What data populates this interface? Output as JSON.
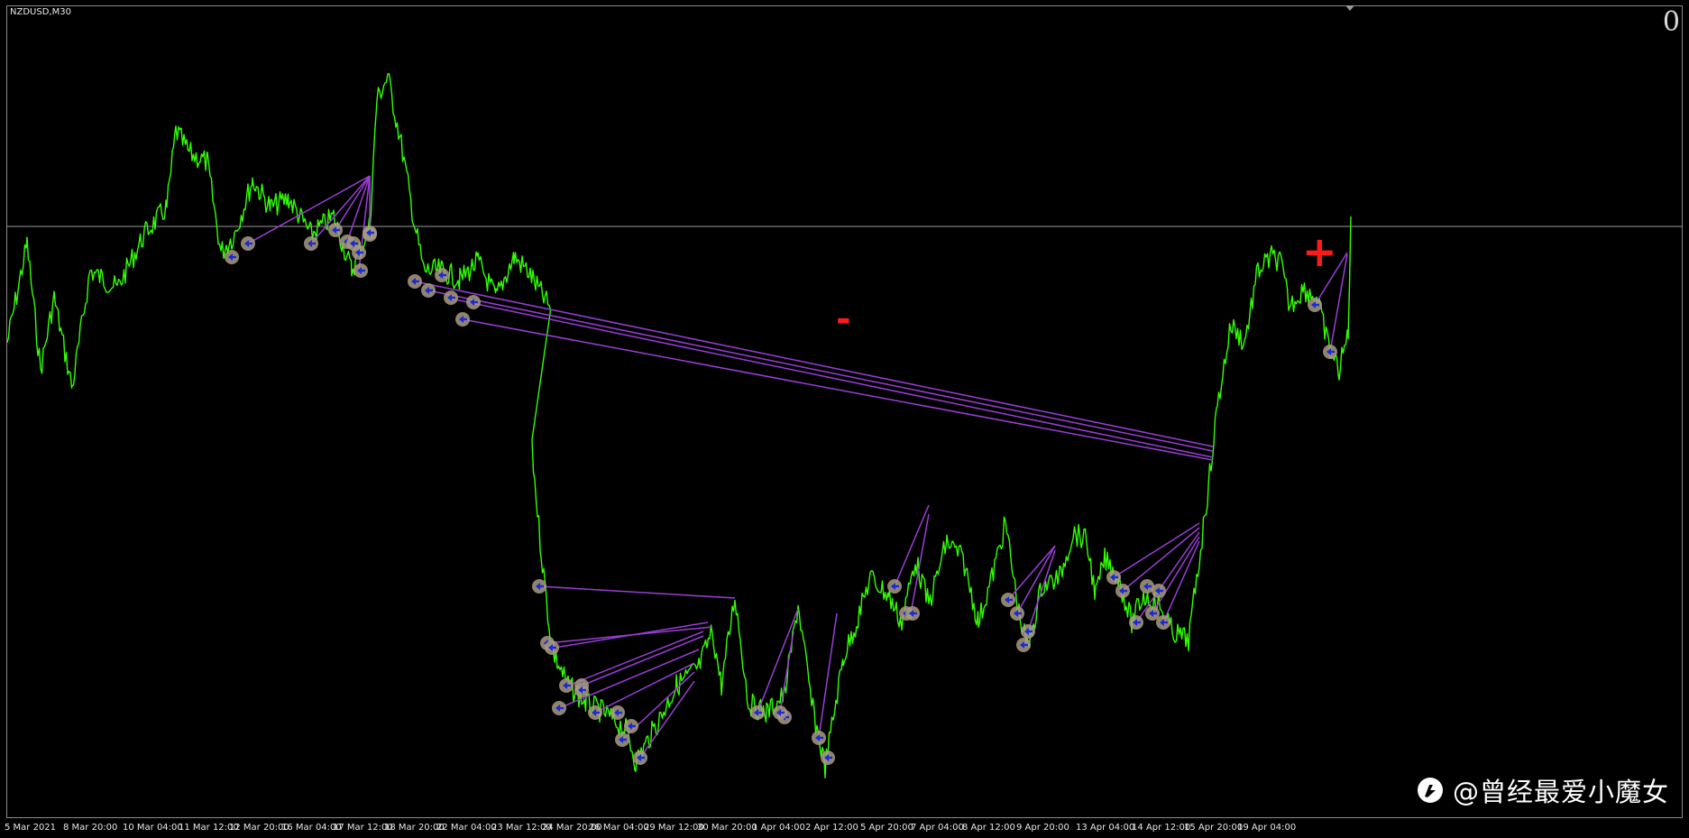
{
  "window": {
    "symbol_timeframe": "NZDUSD,M30",
    "corner_counter": "0"
  },
  "colors": {
    "background": "#000000",
    "price_line": "#33ff00",
    "connector_lines": "#9a3ed6",
    "markers": "#a99a84",
    "plus_mark": "#ff1a1a",
    "minus_mark": "#ff1a1a",
    "horizontal_level": "#9a9a9a"
  },
  "annotations": {
    "plus": "+",
    "minus": "-"
  },
  "time_axis": {
    "labels": [
      "5 Mar 2021",
      "8 Mar 20:00",
      "10 Mar 04:00",
      "11 Mar 12:00",
      "12 Mar 20:00",
      "16 Mar 04:00",
      "17 Mar 12:00",
      "18 Mar 20:00",
      "22 Mar 04:00",
      "23 Mar 12:00",
      "24 Mar 20:00",
      "26 Mar 04:00",
      "29 Mar 12:00",
      "30 Mar 20:00",
      "1 Apr 04:00",
      "2 Apr 12:00",
      "5 Apr 20:00",
      "7 Apr 04:00",
      "8 Apr 12:00",
      "9 Apr 20:00",
      "13 Apr 04:00",
      "14 Apr 12:00",
      "15 Apr 20:00",
      "19 Apr 04:00"
    ]
  },
  "watermark": {
    "icon": "toutiao-logo-icon",
    "text": "@曾经最爱小魔女"
  }
}
